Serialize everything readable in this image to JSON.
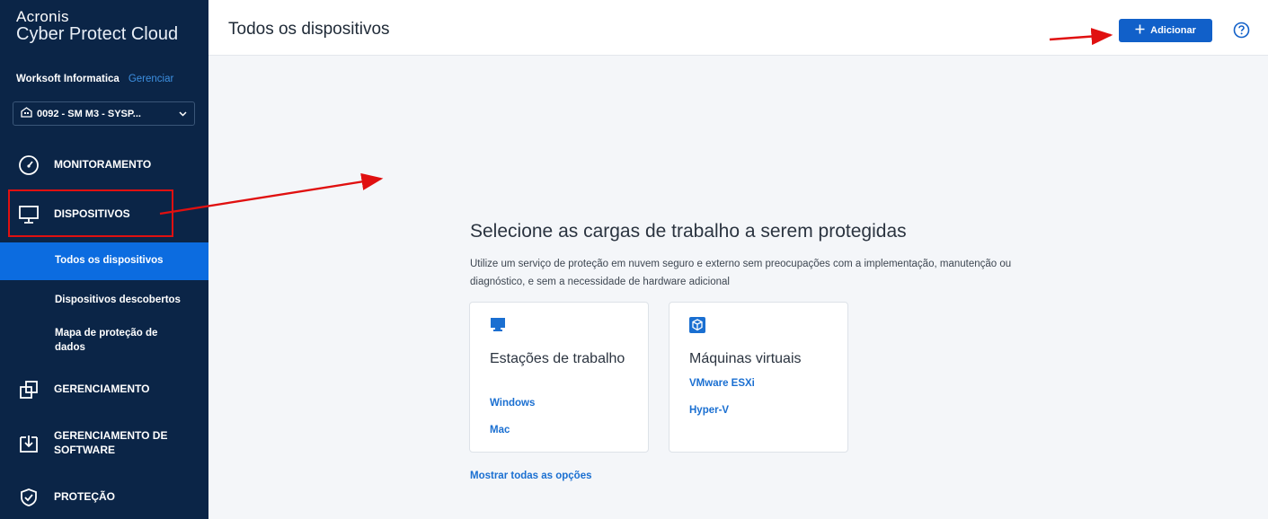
{
  "brand": {
    "line1": "Acronis",
    "line2": "Cyber Protect Cloud"
  },
  "org": {
    "name": "Worksoft Informatica",
    "manage": "Gerenciar"
  },
  "tenant": {
    "value": "0092 - SM M3 - SYSP..."
  },
  "nav": {
    "monitoring": "MONITORAMENTO",
    "devices": "DISPOSITIVOS",
    "sub": [
      "Todos os dispositivos",
      "Dispositivos descobertos",
      "Mapa de proteção de dados"
    ],
    "management": "GERENCIAMENTO",
    "software": "GERENCIAMENTO DE SOFTWARE",
    "protection": "PROTEÇÃO"
  },
  "header": {
    "title": "Todos os dispositivos",
    "add_label": "Adicionar"
  },
  "main": {
    "heading": "Selecione as cargas de trabalho a serem protegidas",
    "description": "Utilize um serviço de proteção em nuvem seguro e externo sem preocupações com a implementação, manutenção ou diagnóstico, e sem a necessidade de hardware adicional",
    "cards": [
      {
        "title": "Estações de trabalho",
        "links": [
          "Windows",
          "Mac"
        ]
      },
      {
        "title": "Máquinas virtuais",
        "links": [
          "VMware ESXi",
          "Hyper-V"
        ]
      }
    ],
    "show_all": "Mostrar todas as opções"
  },
  "colors": {
    "sidebar": "#0b2547",
    "accent": "#1160c9",
    "annotation": "#e01010"
  }
}
